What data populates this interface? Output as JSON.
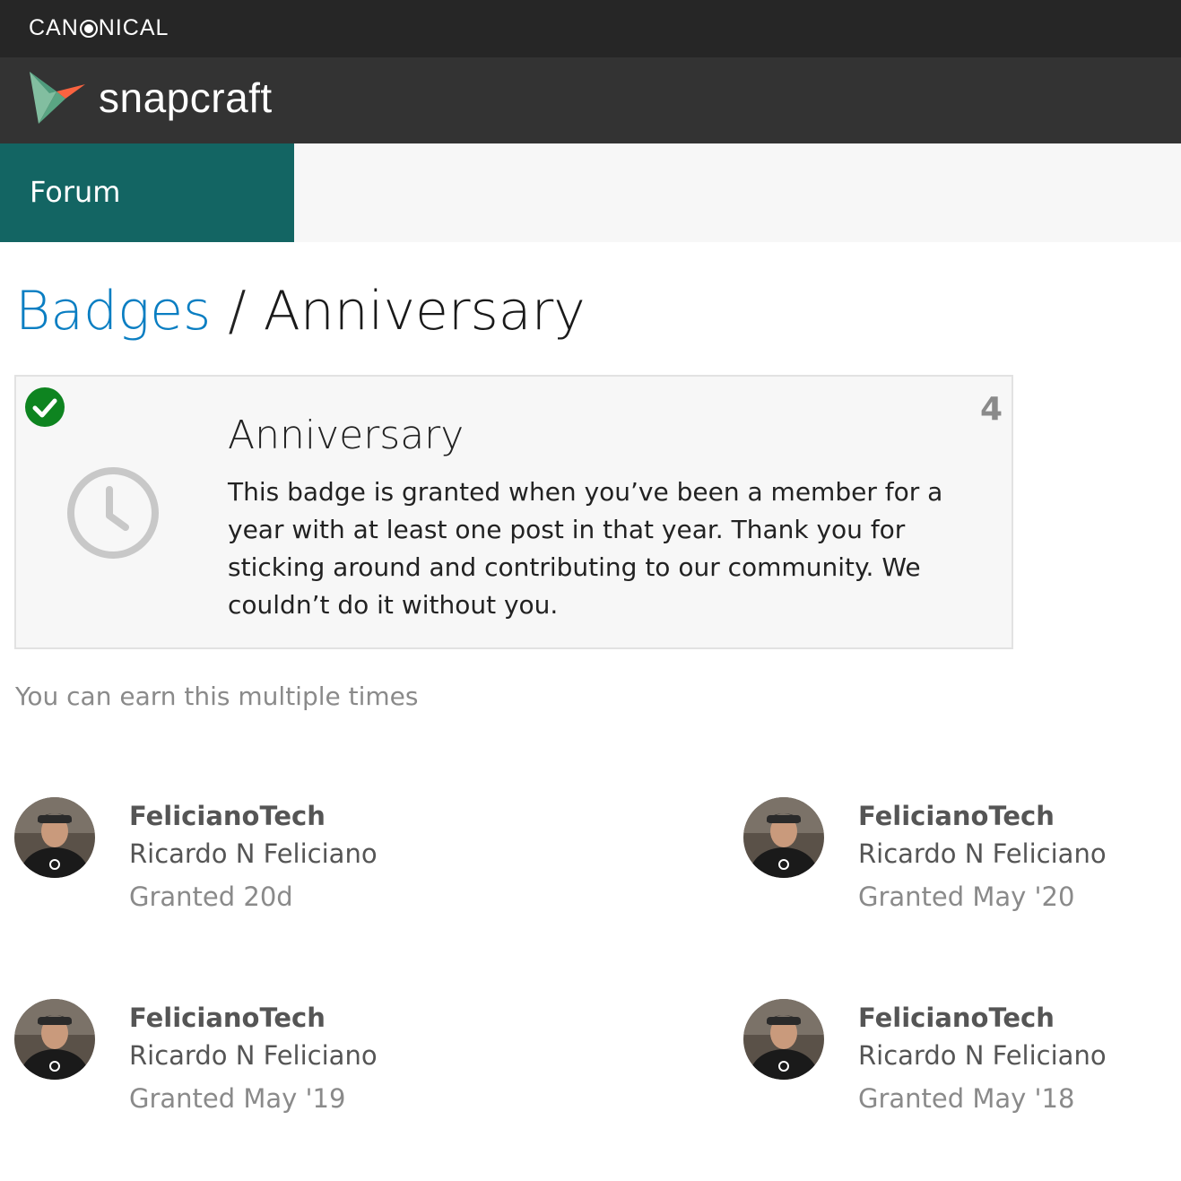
{
  "canonical": {
    "brand_left": "CAN",
    "brand_right": "NICAL"
  },
  "snapcraft": {
    "wordmark": "snapcraft"
  },
  "nav": {
    "forum_label": "Forum"
  },
  "breadcrumb": {
    "link": "Badges",
    "separator": " / ",
    "current": "Anniversary"
  },
  "badge": {
    "name": "Anniversary",
    "count": "4",
    "description": "This badge is granted when you’ve been a member for a year with at least one post in that year. Thank you for sticking around and contributing to our community. We couldn’t do it without you.",
    "icon": "clock-icon",
    "status_icon": "check-icon"
  },
  "earn_note": "You can earn this multiple times",
  "grants": [
    {
      "username": "FelicianoTech",
      "fullname": "Ricardo N Feliciano",
      "granted": "Granted 20d"
    },
    {
      "username": "FelicianoTech",
      "fullname": "Ricardo N Feliciano",
      "granted": "Granted May '20"
    },
    {
      "username": "FelicianoTech",
      "fullname": "Ricardo N Feliciano",
      "granted": "Granted May '19"
    },
    {
      "username": "FelicianoTech",
      "fullname": "Ricardo N Feliciano",
      "granted": "Granted May '18"
    }
  ],
  "colors": {
    "accent": "#136563",
    "link": "#0a7ec2",
    "check": "#0e8420"
  }
}
